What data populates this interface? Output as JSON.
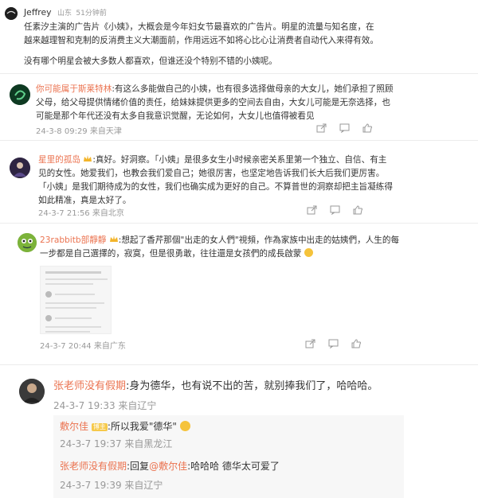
{
  "post": {
    "author": "Jeffrey",
    "location": "山东",
    "time": "51分钟前",
    "line1": "任素汐主演的广告片《小姨》，大概会是今年妇女节最喜欢的广告片。明星的流量与知名度，在",
    "line2": "越来越理智和克制的反消费主义大潮面前，作用远远不如将心比心让消费者自动代入来得有效。",
    "line3": "没有哪个明星会被大多数人都喜欢，但谁还没个特别不错的小姨呢。"
  },
  "comments": [
    {
      "name": "你可能属于斯莱特林",
      "line1": ":有这么多能做自己的小姨，也有很多选择做母亲的大女儿，她们承担了照顾",
      "line2": "父母，给父母提供情绪价值的责任，给妹妹提供更多的空间去自由，大女儿可能是无奈选择，也",
      "line3": "可能是那个年代还没有太多自我意识觉醒，无论如何，大女儿也值得被看见",
      "meta": "24-3-8 09:29 来自天津"
    },
    {
      "name": "星里的孤岛",
      "line1": ":真好。好洞察。「小姨」是很多女生小时候亲密关系里第一个独立、自信、有主",
      "line2": "见的女性。她爱我们，也教会我们爱自己；她很厉害，也坚定地告诉我们长大后我们更厉害。",
      "line3": "「小姨」是我们期待成为的女性，我们也确实成为更好的自己。不算普世的洞察却把主旨凝练得",
      "line4": "如此精准，真是太好了。",
      "meta": "24-3-7 21:56 来自北京"
    },
    {
      "name": "23rabbitb部靜靜",
      "line1": ":想起了香芹那個\"出走的女人們\"視頻，作為家族中出走的姑姨們，人生的每",
      "line2": "一步都是自己選擇的，寂寞，但是很勇敢，往往還是女孩們的成長啟蒙",
      "meta": "24-3-7 20:44 来自广东"
    }
  ],
  "thread": {
    "name": "张老师没有假期",
    "text": ":身为德华，也有说不出的苦，就别捧我们了，哈哈哈。",
    "meta": "24-3-7 19:33 来自辽宁",
    "replies": [
      {
        "name": "敷尔佳",
        "badge": "博主",
        "text": ":所以我爱\"德华\"",
        "meta": "24-3-7 19:37 来自黑龙江"
      },
      {
        "name": "张老师没有假期",
        "reply_prefix": ":回复",
        "mention": "@敷尔佳",
        "text": ":哈哈哈 德华太可爱了",
        "meta": "24-3-7 19:39 来自辽宁"
      }
    ]
  }
}
